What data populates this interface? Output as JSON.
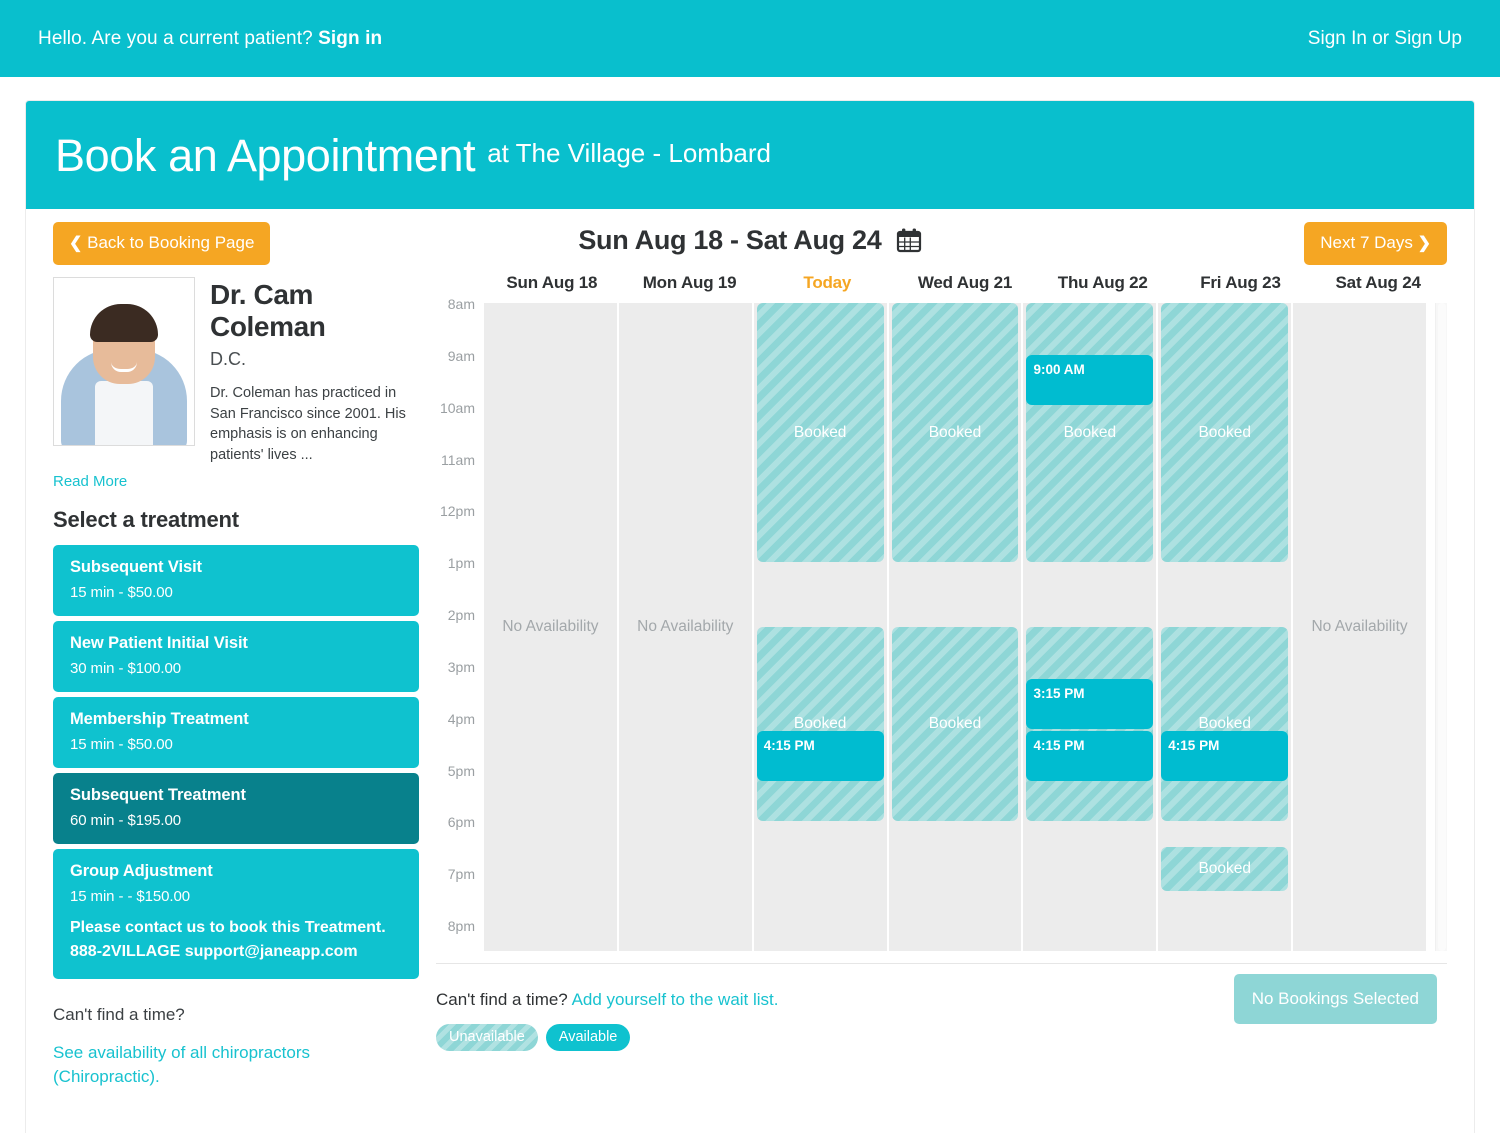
{
  "topbar": {
    "greeting": "Hello. Are you a current patient?",
    "signin_label": "Sign in",
    "signup_label": "Sign In or Sign Up"
  },
  "header": {
    "title": "Book an Appointment",
    "subtitle": "at The Village - Lombard"
  },
  "toolbar": {
    "back_label": "Back to Booking Page",
    "next_label": "Next 7 Days",
    "date_range": "Sun Aug 18 - Sat Aug 24",
    "back_chevron": "❮",
    "next_chevron": "❯",
    "calendar_icon": "calendar-icon"
  },
  "practitioner": {
    "name": "Dr. Cam Coleman",
    "credential": "D.C.",
    "bio": "Dr. Coleman has practiced in San Francisco since 2001. His emphasis is on enhancing patients' lives ...",
    "read_more": "Read More",
    "photo_alt": "practitioner-photo"
  },
  "treatments": {
    "heading": "Select a treatment",
    "items": [
      {
        "name": "Subsequent Visit",
        "meta": "15 min - $50.00",
        "note": "",
        "selected": false
      },
      {
        "name": "New Patient Initial Visit",
        "meta": "30 min - $100.00",
        "note": "",
        "selected": false
      },
      {
        "name": "Membership Treatment",
        "meta": "15 min - $50.00",
        "note": "",
        "selected": false
      },
      {
        "name": "Subsequent Treatment",
        "meta": "60 min - $195.00",
        "note": "",
        "selected": true
      },
      {
        "name": "Group Adjustment",
        "meta": "15 min - - $150.00",
        "note": "Please contact us to book this Treatment. 888-2VILLAGE support@janeapp.com",
        "selected": false
      }
    ]
  },
  "sidebar_footer": {
    "cant_find": "Can't find a time?",
    "see_availability": "See availability of all chiropractors (Chiropractic)."
  },
  "calendar": {
    "time_labels": [
      "8am",
      "9am",
      "10am",
      "11am",
      "12pm",
      "1pm",
      "2pm",
      "3pm",
      "4pm",
      "5pm",
      "6pm",
      "7pm",
      "8pm"
    ],
    "no_availability_label": "No Availability",
    "booked_label": "Booked",
    "days": [
      {
        "label": "Sun Aug 18",
        "today": false,
        "available": false
      },
      {
        "label": "Mon Aug 19",
        "today": false,
        "available": false
      },
      {
        "label": "Today",
        "today": true,
        "available": true
      },
      {
        "label": "Wed Aug 21",
        "today": false,
        "available": true
      },
      {
        "label": "Thu Aug 22",
        "today": false,
        "available": true
      },
      {
        "label": "Fri Aug 23",
        "today": false,
        "available": true
      },
      {
        "label": "Sat Aug 24",
        "today": false,
        "available": false
      }
    ],
    "blocks": [
      {
        "day": 2,
        "start": "8:00am",
        "end": "1:00pm",
        "label": "Booked"
      },
      {
        "day": 2,
        "start": "2:15pm",
        "end": "6:00pm",
        "label": "Booked"
      },
      {
        "day": 3,
        "start": "8:00am",
        "end": "1:00pm",
        "label": "Booked"
      },
      {
        "day": 3,
        "start": "2:15pm",
        "end": "6:00pm",
        "label": "Booked"
      },
      {
        "day": 4,
        "start": "8:00am",
        "end": "1:00pm",
        "label": "Booked"
      },
      {
        "day": 4,
        "start": "2:15pm",
        "end": "6:00pm",
        "label": "Booked"
      },
      {
        "day": 5,
        "start": "8:00am",
        "end": "1:00pm",
        "label": "Booked"
      },
      {
        "day": 5,
        "start": "2:15pm",
        "end": "6:00pm",
        "label": "Booked"
      },
      {
        "day": 5,
        "start": "6:30pm",
        "end": "7:20pm",
        "label": "Booked"
      }
    ],
    "slots": [
      {
        "day": 2,
        "time": "4:15 PM"
      },
      {
        "day": 4,
        "time": "9:00 AM"
      },
      {
        "day": 4,
        "time": "3:15 PM"
      },
      {
        "day": 4,
        "time": "4:15 PM"
      },
      {
        "day": 5,
        "time": "4:15 PM"
      }
    ]
  },
  "footer": {
    "cant_find": "Can't find a time?",
    "wait_list_link": "Add yourself to the wait list.",
    "legend_unavailable": "Unavailable",
    "legend_available": "Available",
    "no_bookings_label": "No Bookings Selected"
  },
  "colors": {
    "brand": "#09bfcd",
    "accent_orange": "#f5a623",
    "slot_available": "#00bcd0",
    "slot_booked": "#8ed6d6",
    "treatment_selected": "#08818c",
    "empty_column": "#ececec"
  }
}
